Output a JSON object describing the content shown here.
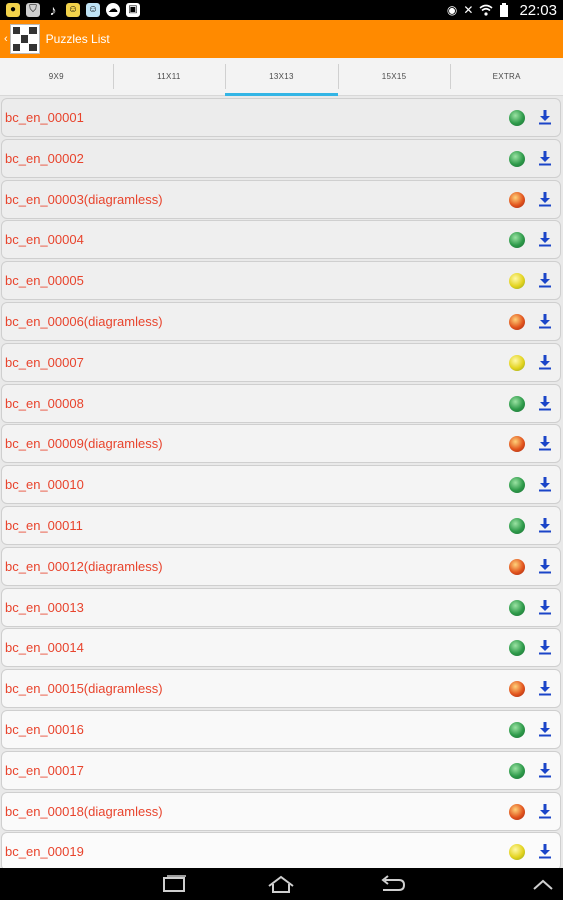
{
  "status_bar": {
    "time": "22:03",
    "left_icons": [
      "notification-icon",
      "shield-icon",
      "music-icon",
      "face-icon",
      "face-icon",
      "cloud-icon",
      "bag-icon"
    ],
    "right_icons": [
      "eye-icon",
      "mute-icon",
      "wifi-icon",
      "battery-icon"
    ]
  },
  "action_bar": {
    "title": "Puzzles List"
  },
  "tabs": [
    {
      "label": "9X9",
      "active": false
    },
    {
      "label": "11X11",
      "active": false
    },
    {
      "label": "13X13",
      "active": true
    },
    {
      "label": "15X15",
      "active": false
    },
    {
      "label": "EXTRA",
      "active": false
    }
  ],
  "puzzles": [
    {
      "name": "bc_en_00001",
      "status": "green"
    },
    {
      "name": "bc_en_00002",
      "status": "green"
    },
    {
      "name": "bc_en_00003(diagramless)",
      "status": "red"
    },
    {
      "name": "bc_en_00004",
      "status": "green"
    },
    {
      "name": "bc_en_00005",
      "status": "yellow"
    },
    {
      "name": "bc_en_00006(diagramless)",
      "status": "red"
    },
    {
      "name": "bc_en_00007",
      "status": "yellow"
    },
    {
      "name": "bc_en_00008",
      "status": "green"
    },
    {
      "name": "bc_en_00009(diagramless)",
      "status": "red"
    },
    {
      "name": "bc_en_00010",
      "status": "green"
    },
    {
      "name": "bc_en_00011",
      "status": "green"
    },
    {
      "name": "bc_en_00012(diagramless)",
      "status": "red"
    },
    {
      "name": "bc_en_00013",
      "status": "green"
    },
    {
      "name": "bc_en_00014",
      "status": "green"
    },
    {
      "name": "bc_en_00015(diagramless)",
      "status": "red"
    },
    {
      "name": "bc_en_00016",
      "status": "green"
    },
    {
      "name": "bc_en_00017",
      "status": "green"
    },
    {
      "name": "bc_en_00018(diagramless)",
      "status": "red"
    },
    {
      "name": "bc_en_00019",
      "status": "yellow"
    }
  ],
  "colors": {
    "accent": "#ff8a00",
    "tab_indicator": "#33b5e5",
    "puzzle_text": "#e8442d",
    "download_icon": "#1b45c8"
  },
  "nav_bar": {
    "icons": [
      "recent-apps-icon",
      "home-icon",
      "back-icon",
      "chevron-up-icon"
    ]
  }
}
